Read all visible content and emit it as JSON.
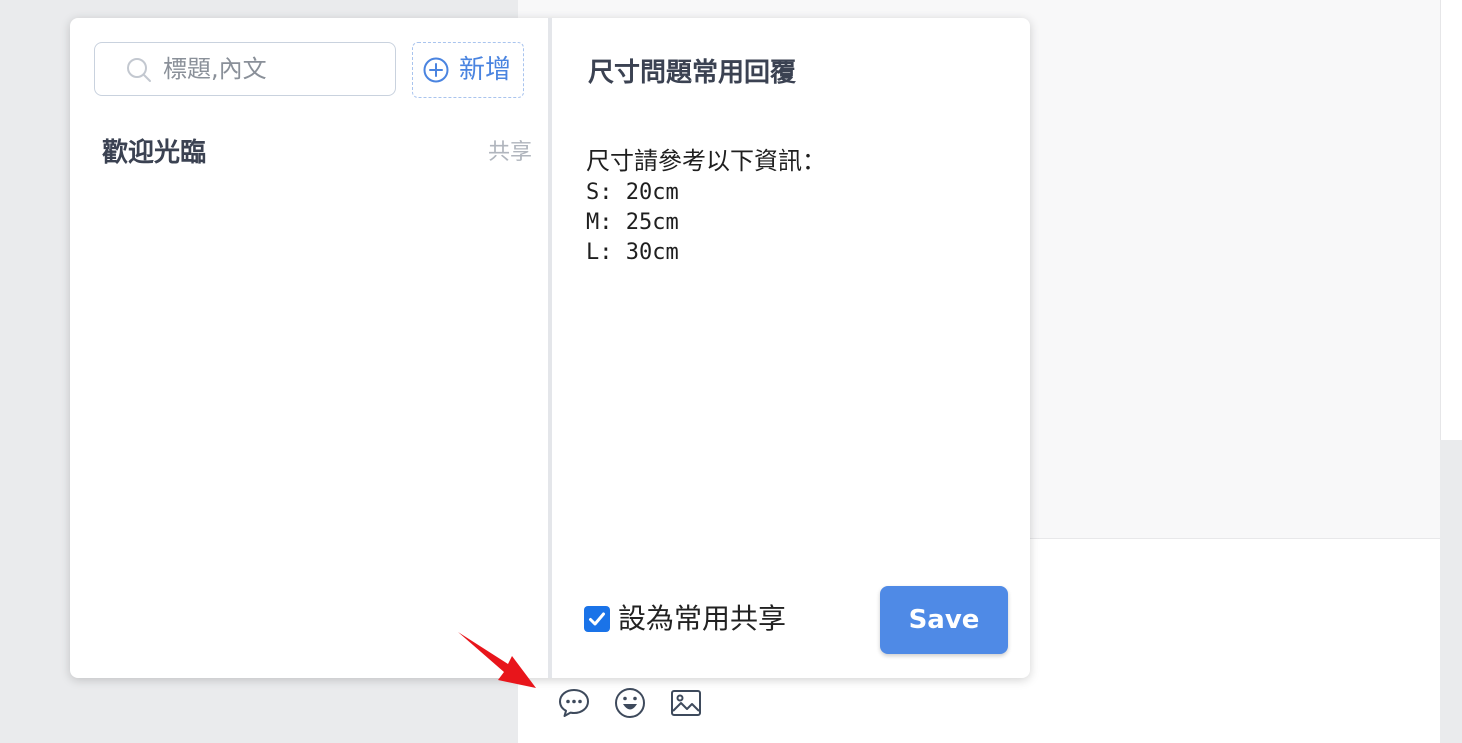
{
  "search": {
    "placeholder": "標題,內文",
    "value": ""
  },
  "toolbar": {
    "add_label": "新增",
    "save_label": "Save"
  },
  "reply_list": [
    {
      "title": "歡迎光臨",
      "tag": "共享"
    }
  ],
  "detail": {
    "title": "尺寸問題常用回覆",
    "body_lines": [
      "尺寸請參考以下資訊：",
      "S: 20cm",
      "M: 25cm",
      "L: 30cm"
    ]
  },
  "share_option": {
    "label": "設為常用共享",
    "checked": true
  },
  "chat_toolbar": {
    "icons": [
      "quick-reply-icon",
      "emoji-icon",
      "image-icon"
    ]
  },
  "colors": {
    "accent": "#4f8ae6",
    "checkbox": "#1a73e8",
    "annotation": "#e8151b"
  }
}
